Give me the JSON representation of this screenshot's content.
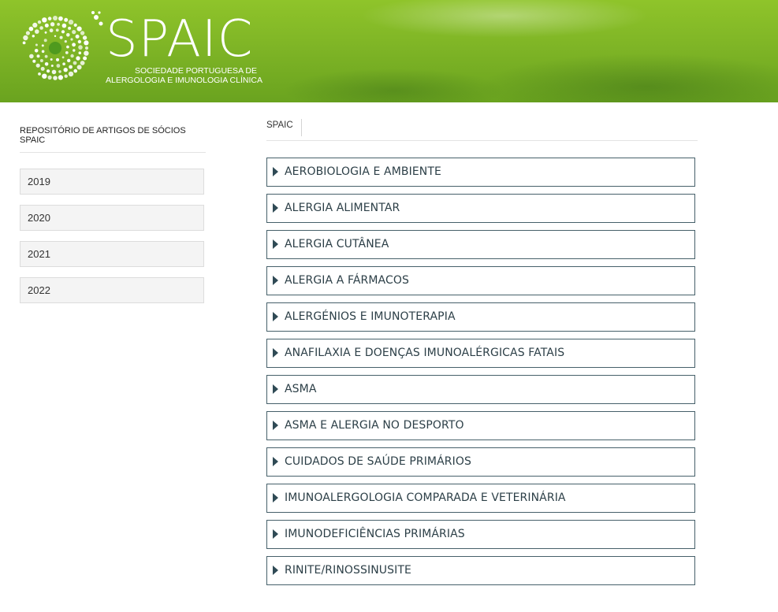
{
  "header": {
    "logo_text": "SPAIC",
    "logo_sub_line1": "SOCIEDADE PORTUGUESA DE",
    "logo_sub_line2": "ALERGOLOGIA E IMUNOLOGIA CLÍNICA"
  },
  "sidebar": {
    "title": "REPOSITÓRIO DE ARTIGOS DE SÓCIOS SPAIC",
    "years": [
      "2019",
      "2020",
      "2021",
      "2022"
    ]
  },
  "breadcrumb": {
    "item": "SPAIC"
  },
  "categories": [
    "AEROBIOLOGIA E AMBIENTE",
    "ALERGIA ALIMENTAR",
    "ALERGIA CUTÂNEA",
    "ALERGIA A FÁRMACOS",
    "ALERGÉNIOS E IMUNOTERAPIA",
    "ANAFILAXIA E DOENÇAS IMUNOALÉRGICAS FATAIS",
    "ASMA",
    "ASMA E ALERGIA NO DESPORTO",
    "CUIDADOS DE SAÚDE PRIMÁRIOS",
    "IMUNOALERGOLOGIA COMPARADA E VETERINÁRIA",
    "IMUNODEFICIÊNCIAS PRIMÁRIAS",
    "RINITE/RINOSSINUSITE"
  ],
  "icons": {
    "logo": "dotted-ring-logo-icon",
    "expand": "caret-right-icon"
  },
  "colors": {
    "header_green": "#7fb526",
    "accordion_border": "#46606a",
    "caret": "#2f4a55"
  }
}
